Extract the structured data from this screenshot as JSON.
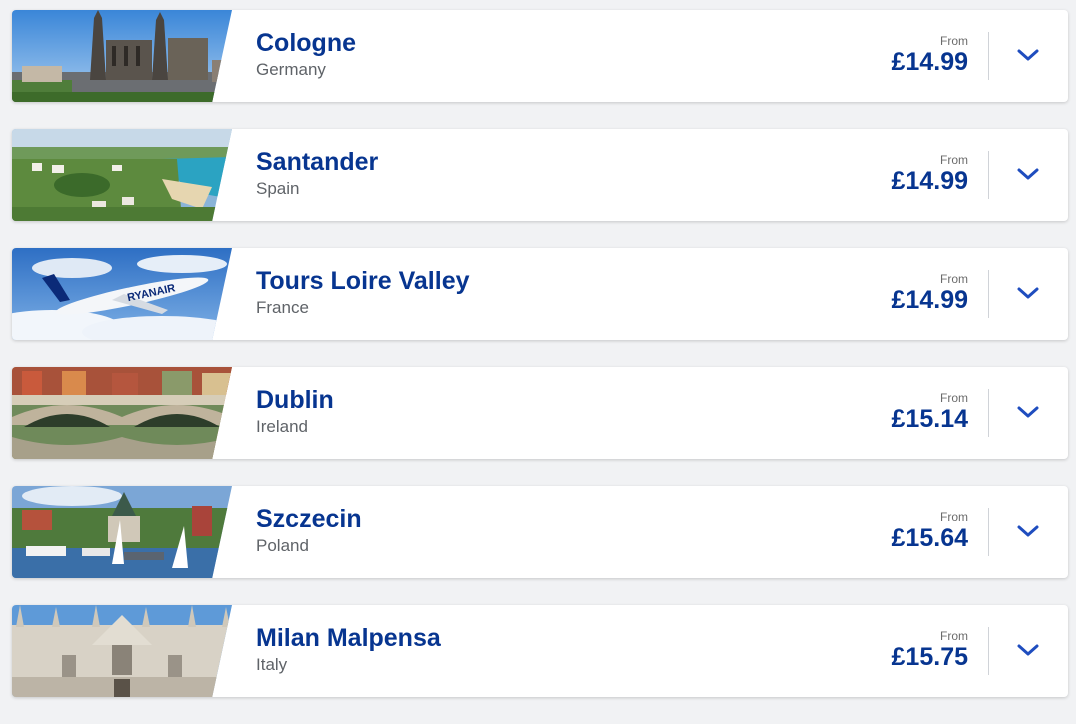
{
  "destinations": [
    {
      "city": "Cologne",
      "country": "Germany",
      "from_label": "From",
      "price": "£14.99",
      "image": "cologne-cathedral-photo"
    },
    {
      "city": "Santander",
      "country": "Spain",
      "from_label": "From",
      "price": "£14.99",
      "image": "santander-coast-photo"
    },
    {
      "city": "Tours Loire Valley",
      "country": "France",
      "from_label": "From",
      "price": "£14.99",
      "image": "ryanair-plane-photo"
    },
    {
      "city": "Dublin",
      "country": "Ireland",
      "from_label": "From",
      "price": "£15.14",
      "image": "dublin-bridge-photo"
    },
    {
      "city": "Szczecin",
      "country": "Poland",
      "from_label": "From",
      "price": "£15.64",
      "image": "szczecin-harbour-photo"
    },
    {
      "city": "Milan Malpensa",
      "country": "Italy",
      "from_label": "From",
      "price": "£15.75",
      "image": "milan-cathedral-photo"
    }
  ],
  "colors": {
    "brand_blue": "#073590",
    "country_gray": "#5f6368",
    "chevron_blue": "#1f4dbf",
    "background": "#f1f2f4"
  },
  "icons": {
    "expand": "chevron-down-icon"
  }
}
